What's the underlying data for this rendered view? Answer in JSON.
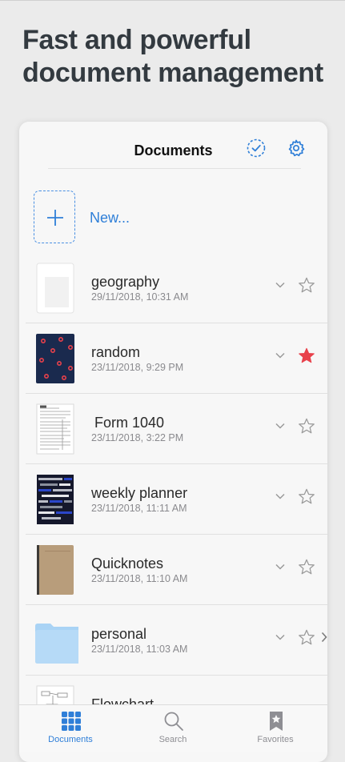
{
  "headline": "Fast and powerful document management",
  "nav": {
    "title": "Documents",
    "select_icon": "select-check-icon",
    "settings_icon": "gear-icon"
  },
  "new_item": {
    "label": "New...",
    "icon": "plus-icon"
  },
  "documents": [
    {
      "name": "geography",
      "date": "29/11/2018, 10:31 AM",
      "thumb": "blank-notebook",
      "favorite": false
    },
    {
      "name": "random",
      "date": "23/11/2018, 9:29 PM",
      "thumb": "dotted-navy-notebook",
      "favorite": true
    },
    {
      "name": "Form 1040",
      "date": "23/11/2018, 3:22 PM",
      "thumb": "tax-form",
      "favorite": false
    },
    {
      "name": "weekly planner",
      "date": "23/11/2018, 11:11 AM",
      "thumb": "striped-planner",
      "favorite": false
    },
    {
      "name": "Quicknotes",
      "date": "23/11/2018, 11:10 AM",
      "thumb": "kraft-notebook",
      "favorite": false
    },
    {
      "name": "personal",
      "date": "23/11/2018, 11:03 AM",
      "thumb": "folder",
      "favorite": false
    },
    {
      "name": "Flowchart",
      "date": "",
      "thumb": "flowchart-page",
      "favorite": false
    }
  ],
  "tabs": [
    {
      "label": "Documents",
      "icon": "grid-icon",
      "active": true
    },
    {
      "label": "Search",
      "icon": "search-icon",
      "active": false
    },
    {
      "label": "Favorites",
      "icon": "bookmark-star-icon",
      "active": false
    }
  ],
  "colors": {
    "accent": "#2f7fd8",
    "favorite": "#e8414b",
    "star_outline": "#9a9a9a",
    "folder": "#a9d3f5"
  }
}
